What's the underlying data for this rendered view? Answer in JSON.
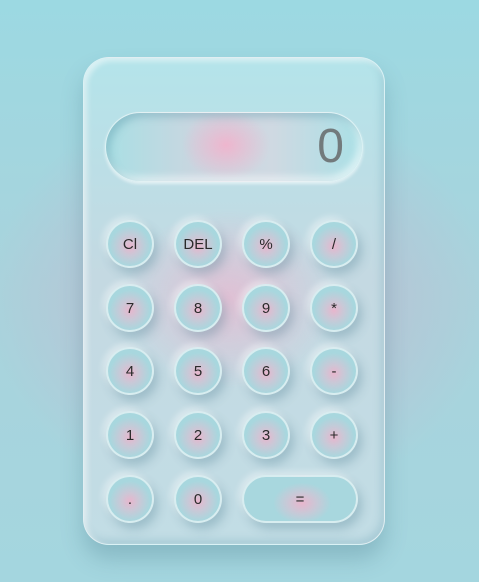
{
  "display": {
    "value": "0"
  },
  "keys": {
    "clear": "Cl",
    "delete": "DEL",
    "percent": "%",
    "divide": "/",
    "seven": "7",
    "eight": "8",
    "nine": "9",
    "multiply": "*",
    "four": "4",
    "five": "5",
    "six": "6",
    "subtract": "-",
    "one": "1",
    "two": "2",
    "three": "3",
    "add": "+",
    "decimal": ".",
    "zero": "0",
    "equals": "="
  },
  "colors": {
    "background": "#a4d6df",
    "key_base": "#a8d7de",
    "key_glow": "#ecb4cc",
    "display_text": "#727a7c"
  }
}
